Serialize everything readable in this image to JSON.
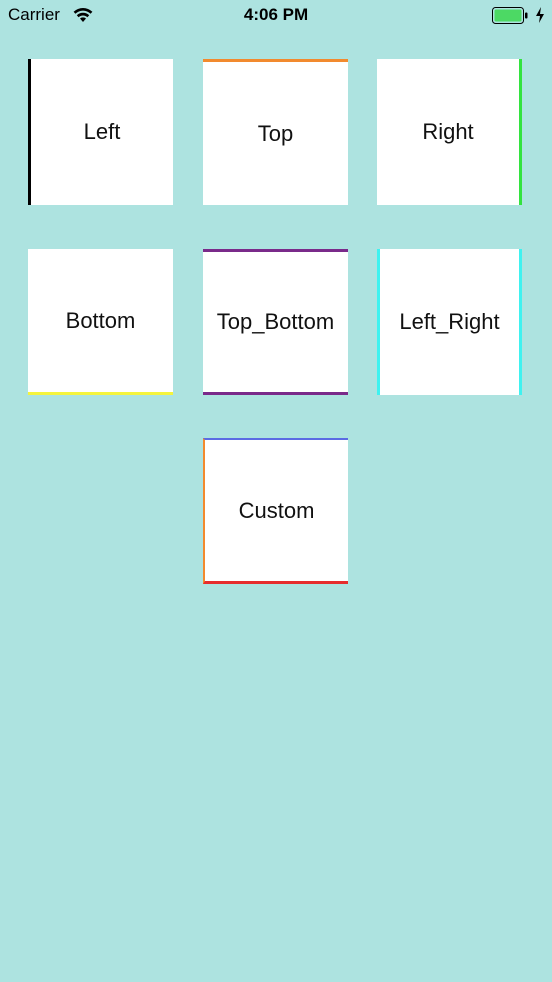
{
  "status_bar": {
    "carrier": "Carrier",
    "time": "4:06 PM",
    "wifi_icon": "wifi-icon",
    "battery_icon": "battery-icon",
    "charging_icon": "charging-bolt-icon"
  },
  "colors": {
    "background": "#ade3e0",
    "tile": "#ffffff",
    "left": "#000000",
    "top": "#f28a2e",
    "right": "#33e33f",
    "bottom": "#f4f43c",
    "top_bottom": "#7a2a8a",
    "left_right": "#3ff2f0",
    "custom_top": "#5b6be3",
    "custom_left": "#f28a2e",
    "custom_bottom": "#e62d2d"
  },
  "tiles": [
    {
      "label": "Left"
    },
    {
      "label": "Top"
    },
    {
      "label": "Right"
    },
    {
      "label": "Bottom"
    },
    {
      "label": "Top_Bottom"
    },
    {
      "label": "Left_Right"
    },
    {
      "label": "Custom"
    }
  ]
}
